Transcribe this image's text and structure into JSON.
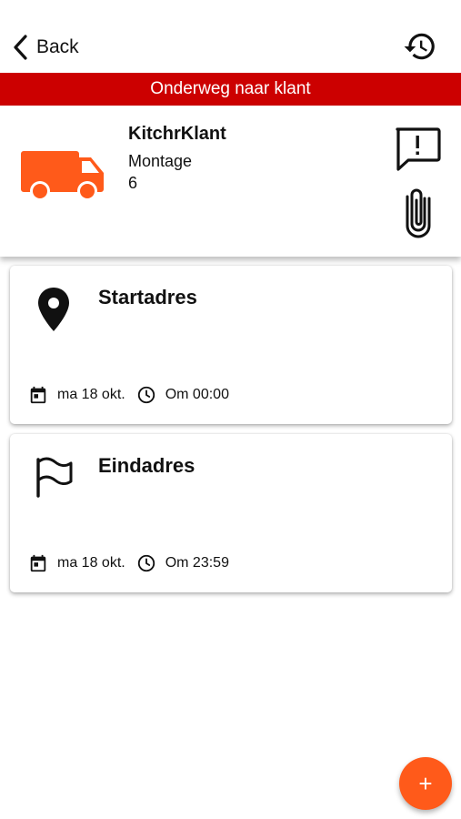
{
  "nav": {
    "back_label": "Back"
  },
  "banner": {
    "status": "Onderweg naar klant",
    "color": "#cc0000"
  },
  "job": {
    "customer": "KitchrKlant",
    "type": "Montage",
    "number": "6",
    "van_color": "#ff5a1a"
  },
  "addresses": [
    {
      "title": "Startadres",
      "date": "ma 18 okt.",
      "time": "Om 00:00",
      "icon": "location-pin-icon"
    },
    {
      "title": "Eindadres",
      "date": "ma 18 okt.",
      "time": "Om 23:59",
      "icon": "flag-icon"
    }
  ],
  "fab": {
    "label": "+",
    "color": "#ff5a1a"
  }
}
